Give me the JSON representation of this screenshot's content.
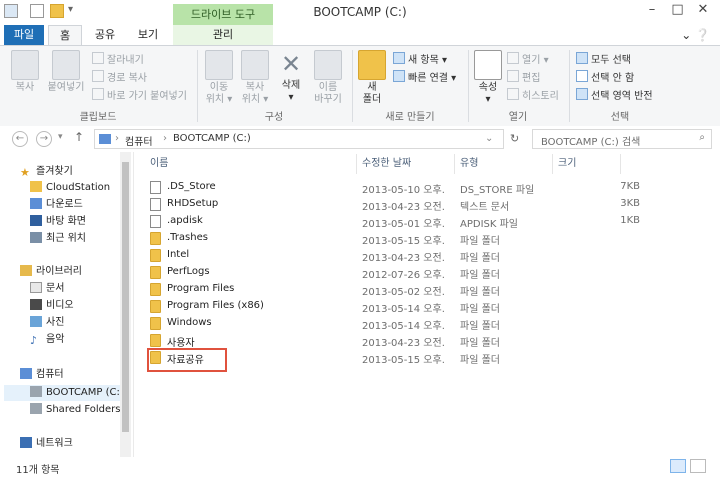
{
  "window": {
    "title": "BOOTCAMP (C:)",
    "context_tab_header": "드라이브 도구"
  },
  "tabs": [
    "파일",
    "홈",
    "공유",
    "보기",
    "관리"
  ],
  "ribbon": {
    "clipboard": {
      "label": "클립보드",
      "copy": "복사",
      "paste": "붙여넣기",
      "cut": "잘라내기",
      "copy_path": "경로 복사",
      "paste_shortcut": "바로 가기 붙여넣기"
    },
    "organize": {
      "label": "구성",
      "move_to": [
        "이동",
        "위치"
      ],
      "copy_to": [
        "복사",
        "위치"
      ],
      "delete": "삭제",
      "rename": [
        "이름",
        "바꾸기"
      ]
    },
    "new": {
      "label": "새로 만들기",
      "new_folder": [
        "새",
        "폴더"
      ],
      "new_item": "새 항목",
      "easy_access": "빠른 연결"
    },
    "open": {
      "label": "열기",
      "properties": "속성",
      "open": "열기",
      "edit": "편집",
      "history": "히스토리"
    },
    "select": {
      "label": "선택",
      "select_all": "모두 선택",
      "select_none": "선택 안 함",
      "invert": "선택 영역 반전"
    }
  },
  "address": {
    "crumbs": [
      "컴퓨터",
      "BOOTCAMP (C:)"
    ],
    "search_placeholder": "BOOTCAMP (C:) 검색"
  },
  "nav": {
    "favorites": "즐겨찾기",
    "fav_items": [
      "CloudStation",
      "다운로드",
      "바탕 화면",
      "최근 위치"
    ],
    "libraries": "라이브러리",
    "lib_items": [
      "문서",
      "비디오",
      "사진",
      "음악"
    ],
    "computer": "컴퓨터",
    "comp_items": [
      "BOOTCAMP (C:)",
      "Shared Folders(\\"
    ],
    "network": "네트워크"
  },
  "columns": [
    "이름",
    "수정한 날짜",
    "유형",
    "크기"
  ],
  "files": [
    {
      "name": ".DS_Store",
      "date": "2013-05-10 오후...",
      "type": "DS_STORE 파일",
      "size": "7KB",
      "kind": "file"
    },
    {
      "name": "RHDSetup",
      "date": "2013-04-23 오전...",
      "type": "텍스트 문서",
      "size": "3KB",
      "kind": "file"
    },
    {
      "name": ".apdisk",
      "date": "2013-05-01 오후...",
      "type": "APDISK 파일",
      "size": "1KB",
      "kind": "file"
    },
    {
      "name": ".Trashes",
      "date": "2013-05-15 오후...",
      "type": "파일 폴더",
      "size": "",
      "kind": "folder"
    },
    {
      "name": "Intel",
      "date": "2013-04-23 오전...",
      "type": "파일 폴더",
      "size": "",
      "kind": "folder"
    },
    {
      "name": "PerfLogs",
      "date": "2012-07-26 오후...",
      "type": "파일 폴더",
      "size": "",
      "kind": "folder"
    },
    {
      "name": "Program Files",
      "date": "2013-05-02 오전...",
      "type": "파일 폴더",
      "size": "",
      "kind": "folder"
    },
    {
      "name": "Program Files (x86)",
      "date": "2013-05-14 오후...",
      "type": "파일 폴더",
      "size": "",
      "kind": "folder"
    },
    {
      "name": "Windows",
      "date": "2013-05-14 오후...",
      "type": "파일 폴더",
      "size": "",
      "kind": "folder"
    },
    {
      "name": "사용자",
      "date": "2013-04-23 오전...",
      "type": "파일 폴더",
      "size": "",
      "kind": "folder"
    },
    {
      "name": "자료공유",
      "date": "2013-05-15 오후...",
      "type": "파일 폴더",
      "size": "",
      "kind": "folder"
    }
  ],
  "status": {
    "item_count": "11개 항목"
  },
  "colors": {
    "accent": "#1f6fb6",
    "context_tab": "#b8e3a8",
    "highlight": "#e0523e"
  }
}
